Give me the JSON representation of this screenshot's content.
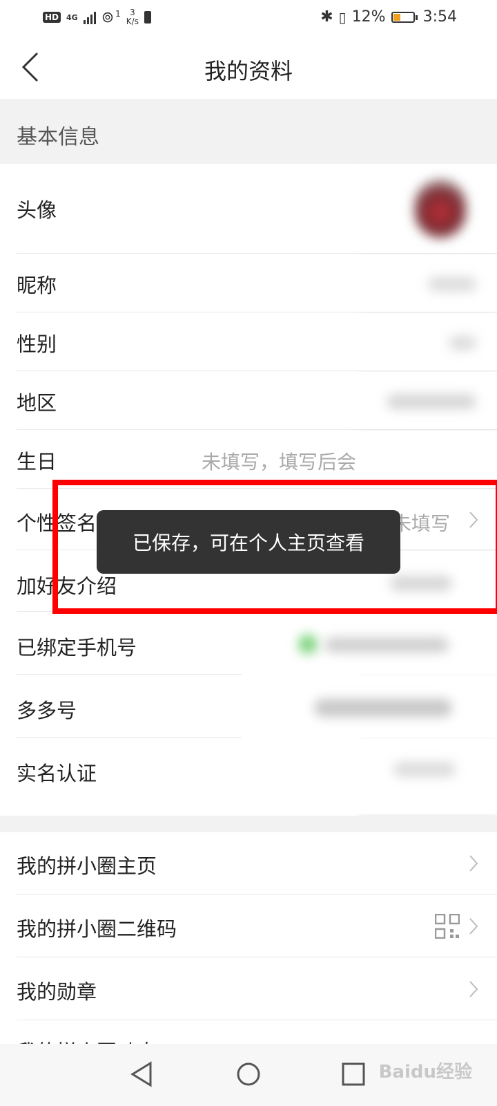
{
  "status_bar": {
    "network_badge": "HD",
    "network_type": "4G",
    "wifi_count": "1",
    "speed_value": "3",
    "speed_unit": "K/s",
    "battery_percent": "12%",
    "battery_level": 0.12,
    "time": "3:54",
    "icons": [
      "signal-icon",
      "hotspot-icon",
      "alert-icon",
      "bluetooth-icon",
      "vibrate-icon",
      "battery-icon"
    ]
  },
  "navbar": {
    "title": "我的资料"
  },
  "section": {
    "basic_info_title": "基本信息"
  },
  "rows": {
    "avatar": "头像",
    "nickname": "昵称",
    "gender": "性别",
    "region": "地区",
    "birthday": "生日",
    "birthday_value": "未填写，填写后会",
    "signature": "个性签名",
    "signature_value": "未填写",
    "friend_intro": "加好友介绍",
    "phone": "已绑定手机号",
    "duoduo_id": "多多号",
    "real_name": "实名认证"
  },
  "links": {
    "circle_home": "我的拼小圈主页",
    "circle_qr": "我的拼小圈二维码",
    "badges": "我的勋章",
    "partial_next": "我的拼小圈动态"
  },
  "toast": {
    "message": "已保存，可在个人主页查看"
  },
  "bottom_nav": {
    "watermark": "Baidu经验"
  },
  "colors": {
    "highlight_border": "#ff0000",
    "toast_bg": "#333333",
    "battery_fill": "#f0a020"
  }
}
